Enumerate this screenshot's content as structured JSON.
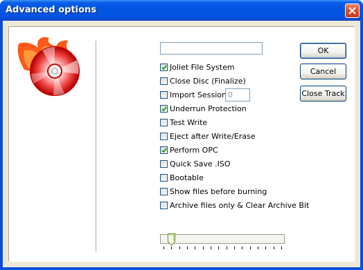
{
  "window": {
    "title": "Advanced options"
  },
  "name_field": {
    "value": ""
  },
  "options": [
    {
      "label": "Joliet File System",
      "checked": true
    },
    {
      "label": "Close Disc (Finalize)",
      "checked": false
    },
    {
      "label": "Import Session",
      "checked": false
    },
    {
      "label": "Underrun Protection",
      "checked": true
    },
    {
      "label": "Test Write",
      "checked": false
    },
    {
      "label": "Eject after Write/Erase",
      "checked": false
    },
    {
      "label": "Perform OPC",
      "checked": true
    },
    {
      "label": "Quick Save .ISO",
      "checked": false
    },
    {
      "label": "Bootable",
      "checked": false
    },
    {
      "label": "Show files before burning",
      "checked": false
    },
    {
      "label": "Archive files only & Clear Archive Bit",
      "checked": false
    }
  ],
  "import_session": {
    "value": "0"
  },
  "buttons": {
    "ok": "OK",
    "cancel": "Cancel",
    "close_track": "Close Track"
  },
  "slider": {
    "value": 1,
    "max": 15
  },
  "colors": {
    "titlebar": "#0454e2",
    "accent": "#d8502f",
    "dialog_bg": "#ece9d8"
  }
}
